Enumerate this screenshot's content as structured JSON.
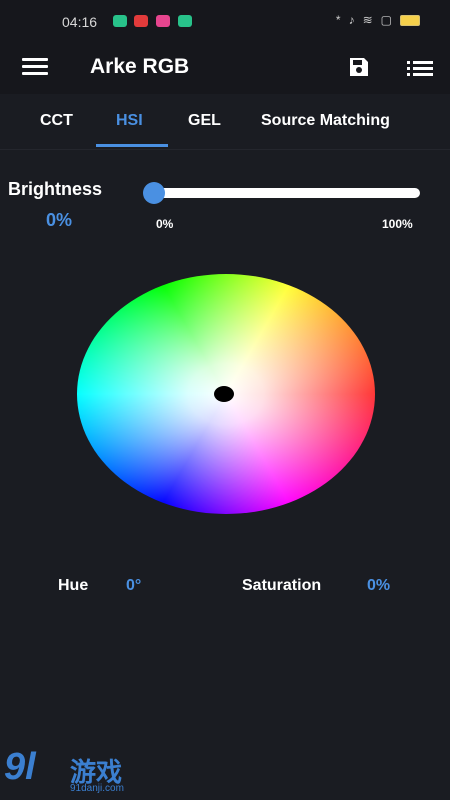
{
  "status_bar": {
    "time": "04:16",
    "right_icons": [
      "*",
      "♪",
      "≋",
      "▢"
    ]
  },
  "app_bar": {
    "title": "Arke RGB"
  },
  "tabs": [
    {
      "label": "CCT",
      "active": false
    },
    {
      "label": "HSI",
      "active": true
    },
    {
      "label": "GEL",
      "active": false
    },
    {
      "label": "Source Matching",
      "active": false
    }
  ],
  "brightness": {
    "label": "Brightness",
    "value": "0%",
    "min_label": "0%",
    "max_label": "100%",
    "level": 0
  },
  "color_wheel": {
    "hue": "0°",
    "saturation": "0%"
  },
  "readouts": {
    "hue_label": "Hue",
    "hue_value": "0°",
    "saturation_label": "Saturation",
    "saturation_value": "0%"
  },
  "watermark": {
    "logo": "9l",
    "text": "游戏",
    "url": "91danji.com"
  },
  "colors": {
    "accent": "#4a90e2",
    "background": "#1a1c22",
    "bar": "#16171c"
  }
}
